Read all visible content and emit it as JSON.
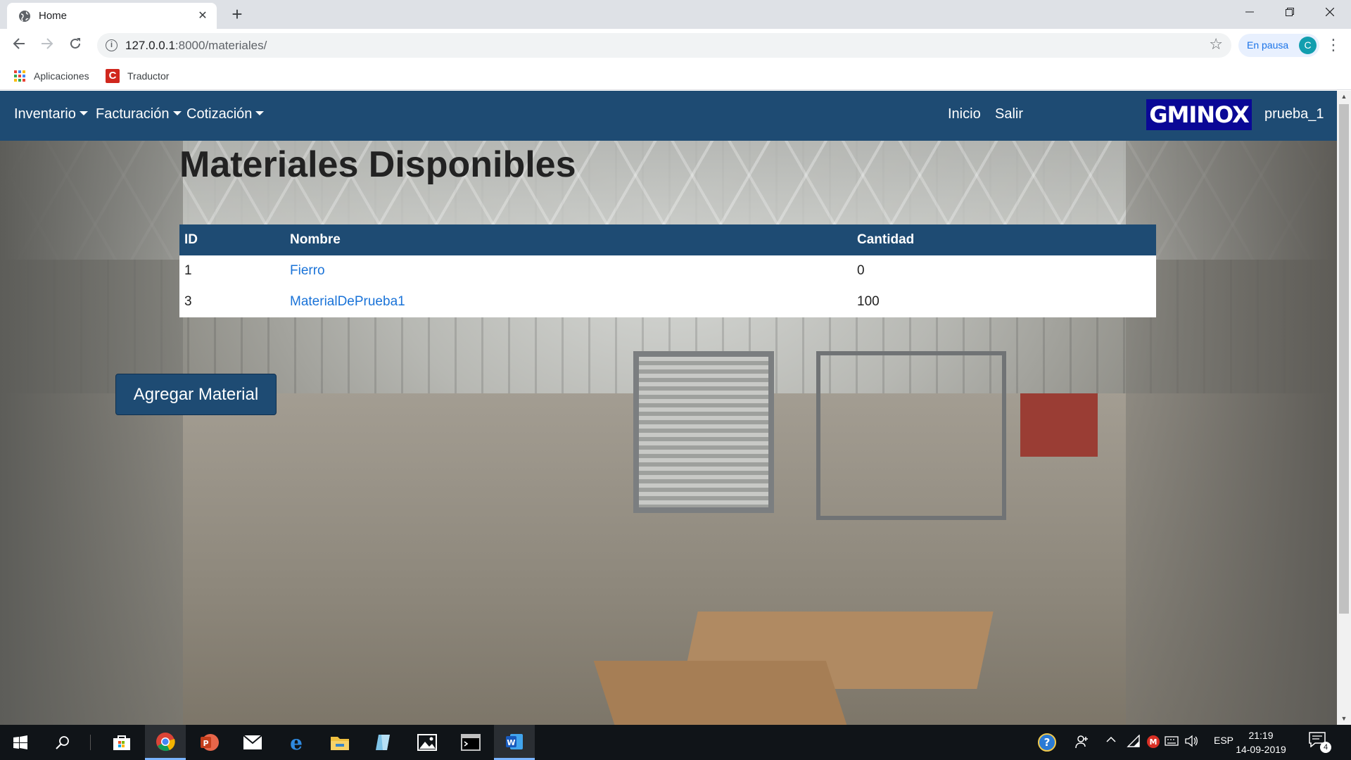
{
  "browser": {
    "tab_title": "Home",
    "close_tab_glyph": "✕",
    "new_tab_glyph": "+",
    "url_host": "127.0.0.1",
    "url_path": ":8000/materiales/",
    "profile_label": "En pausa",
    "profile_initial": "C",
    "bookmarks": [
      {
        "label": "Aplicaciones",
        "icon": "apps-grid-icon"
      },
      {
        "label": "Traductor",
        "icon": "translator-icon"
      }
    ]
  },
  "navbar": {
    "menus": [
      {
        "label": "Inventario",
        "has_dropdown": true
      },
      {
        "label": "Facturación",
        "has_dropdown": true
      },
      {
        "label": "Cotización",
        "has_dropdown": true
      }
    ],
    "links": [
      {
        "label": "Inicio"
      },
      {
        "label": "Salir"
      }
    ],
    "brand": "GMINOX",
    "user": "prueba_1",
    "color": "#1e4b73",
    "brand_color": "#0a0896"
  },
  "main": {
    "title": "Materiales Disponibles",
    "table": {
      "columns": [
        "ID",
        "Nombre",
        "Cantidad"
      ],
      "rows": [
        {
          "id": "1",
          "nombre": "Fierro",
          "cantidad": "0"
        },
        {
          "id": "3",
          "nombre": "MaterialDePrueba1",
          "cantidad": "100"
        }
      ]
    },
    "add_button": "Agregar Material",
    "link_color": "#1a73d8"
  },
  "taskbar": {
    "apps": [
      "windows-start-icon",
      "search-icon",
      "store-icon",
      "chrome-icon",
      "powerpoint-icon",
      "mail-icon",
      "edge-icon",
      "file-explorer-icon",
      "sticky-app-icon",
      "photos-icon",
      "terminal-icon",
      "word-icon"
    ],
    "language": "ESP",
    "time": "21:19",
    "date": "14-09-2019",
    "notification_count": "4"
  }
}
